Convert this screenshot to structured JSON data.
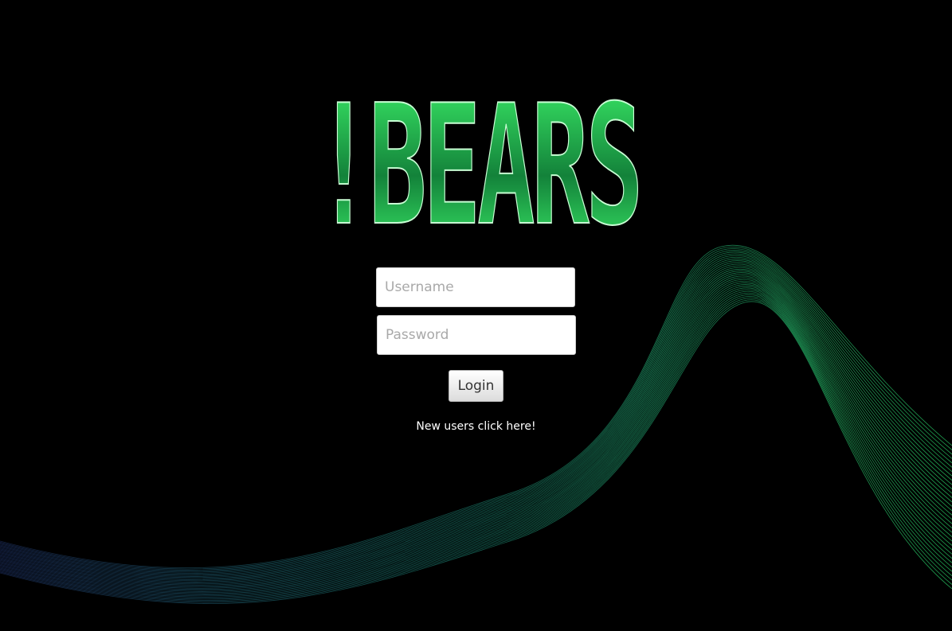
{
  "brand": {
    "logo_text": "!BEARS",
    "color_light": "#3df26a",
    "color_dark": "#13823a"
  },
  "login_form": {
    "username_placeholder": "Username",
    "password_placeholder": "Password",
    "login_label": "Login",
    "signup_link_text": "New users click here!"
  },
  "theme": {
    "background": "#000000",
    "wave_color_start": "#1a2a55",
    "wave_color_end": "#2bd46a"
  }
}
